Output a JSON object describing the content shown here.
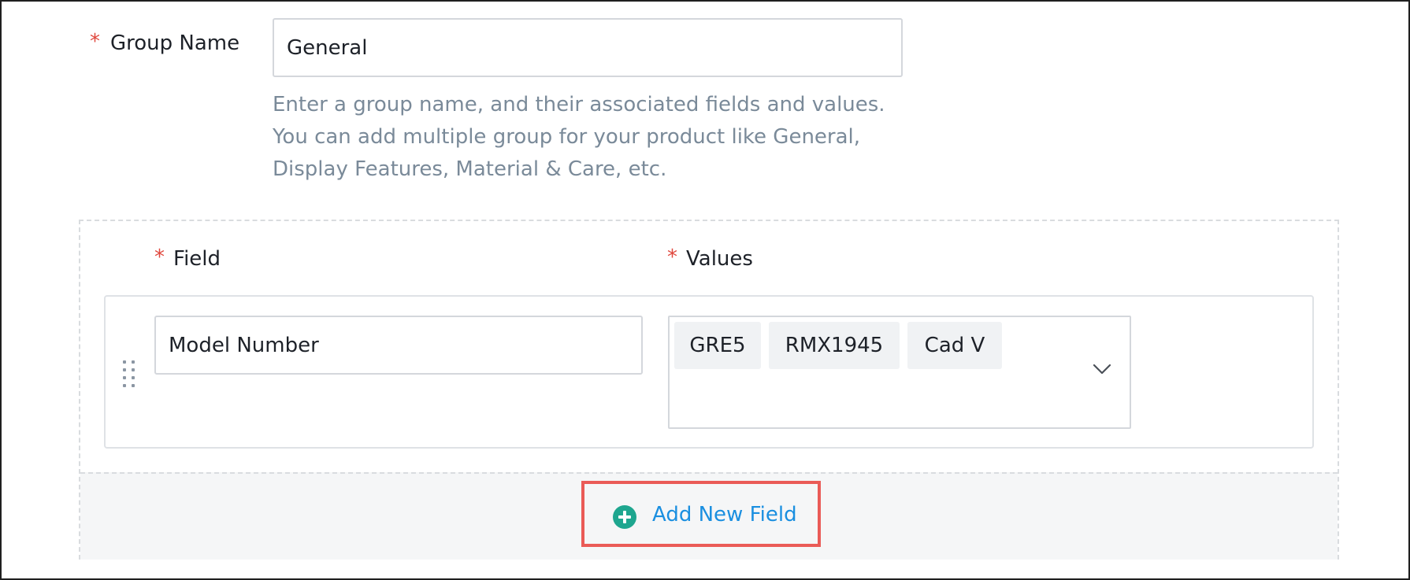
{
  "group": {
    "label": "Group Name",
    "required_mark": "*",
    "value": "General",
    "help_lines": [
      "Enter a group name, and their associated fields and values.",
      "You can add multiple group for your product like General,",
      "Display Features, Material & Care, etc."
    ]
  },
  "fields": {
    "field_label": "Field",
    "values_label": "Values",
    "required_mark": "*",
    "rows": [
      {
        "field_value": "Model Number",
        "values": [
          "GRE5",
          "RMX1945",
          "Cad V"
        ]
      }
    ]
  },
  "actions": {
    "add_new_field": "Add New Field"
  },
  "colors": {
    "required": "#e0483e",
    "link": "#1a8fe0",
    "add_icon": "#1ea68f",
    "highlight": "#ea5b57",
    "help_text": "#7a8a99"
  },
  "icons": {
    "add": "plus-circle-icon",
    "drag": "drag-handle-icon",
    "dropdown": "chevron-down-icon"
  }
}
